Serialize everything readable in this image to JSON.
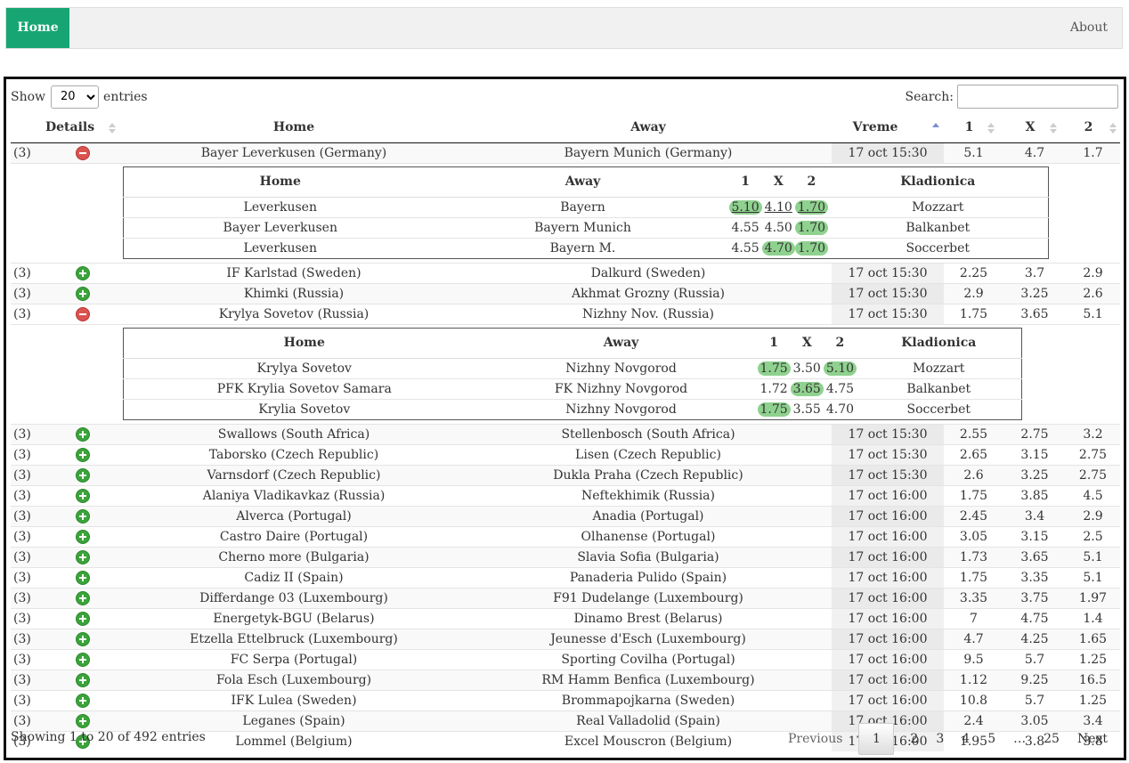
{
  "nav": {
    "home": "Home",
    "about": "About"
  },
  "length": {
    "show": "Show",
    "value": "20",
    "entries": "entries"
  },
  "search": {
    "label": "Search:",
    "value": ""
  },
  "columns": [
    "",
    "Details",
    "Home",
    "Away",
    "Vreme",
    "1",
    "X",
    "2"
  ],
  "rows": [
    {
      "count": "(3)",
      "open": true,
      "home": "Bayer Leverkusen (Germany)",
      "away": "Bayern Munich (Germany)",
      "time": "17 oct 15:30",
      "o1": "5.1",
      "ox": "4.7",
      "o2": "1.7",
      "details": [
        {
          "home": "Leverkusen",
          "away": "Bayern",
          "o1": "5.10",
          "ox": "4.10",
          "o2": "1.70",
          "book": "Mozzart",
          "hl": [
            1,
            0,
            1
          ],
          "ul": [
            1,
            1,
            1
          ]
        },
        {
          "home": "Bayer Leverkusen",
          "away": "Bayern Munich",
          "o1": "4.55",
          "ox": "4.50",
          "o2": "1.70",
          "book": "Balkanbet",
          "hl": [
            0,
            0,
            1
          ],
          "ul": [
            0,
            0,
            0
          ]
        },
        {
          "home": "Leverkusen",
          "away": "Bayern M.",
          "o1": "4.55",
          "ox": "4.70",
          "o2": "1.70",
          "book": "Soccerbet",
          "hl": [
            0,
            1,
            1
          ],
          "ul": [
            0,
            0,
            0
          ]
        }
      ]
    },
    {
      "count": "(3)",
      "open": false,
      "home": "IF Karlstad (Sweden)",
      "away": "Dalkurd (Sweden)",
      "time": "17 oct 15:30",
      "o1": "2.25",
      "ox": "3.7",
      "o2": "2.9"
    },
    {
      "count": "(3)",
      "open": false,
      "home": "Khimki (Russia)",
      "away": "Akhmat Grozny (Russia)",
      "time": "17 oct 15:30",
      "o1": "2.9",
      "ox": "3.25",
      "o2": "2.6"
    },
    {
      "count": "(3)",
      "open": true,
      "home": "Krylya Sovetov (Russia)",
      "away": "Nizhny Nov. (Russia)",
      "time": "17 oct 15:30",
      "o1": "1.75",
      "ox": "3.65",
      "o2": "5.1",
      "details": [
        {
          "home": "Krylya Sovetov",
          "away": "Nizhny Novgorod",
          "o1": "1.75",
          "ox": "3.50",
          "o2": "5.10",
          "book": "Mozzart",
          "hl": [
            1,
            0,
            1
          ],
          "ul": [
            0,
            0,
            0
          ]
        },
        {
          "home": "PFK Krylia Sovetov Samara",
          "away": "FK Nizhny Novgorod",
          "o1": "1.72",
          "ox": "3.65",
          "o2": "4.75",
          "book": "Balkanbet",
          "hl": [
            0,
            1,
            0
          ],
          "ul": [
            0,
            0,
            0
          ]
        },
        {
          "home": "Krylia Sovetov",
          "away": "Nizhny Novgorod",
          "o1": "1.75",
          "ox": "3.55",
          "o2": "4.70",
          "book": "Soccerbet",
          "hl": [
            1,
            0,
            0
          ],
          "ul": [
            0,
            0,
            0
          ]
        }
      ]
    },
    {
      "count": "(3)",
      "open": false,
      "home": "Swallows (South Africa)",
      "away": "Stellenbosch (South Africa)",
      "time": "17 oct 15:30",
      "o1": "2.55",
      "ox": "2.75",
      "o2": "3.2"
    },
    {
      "count": "(3)",
      "open": false,
      "home": "Taborsko (Czech Republic)",
      "away": "Lisen (Czech Republic)",
      "time": "17 oct 15:30",
      "o1": "2.65",
      "ox": "3.15",
      "o2": "2.75"
    },
    {
      "count": "(3)",
      "open": false,
      "home": "Varnsdorf (Czech Republic)",
      "away": "Dukla Praha (Czech Republic)",
      "time": "17 oct 15:30",
      "o1": "2.6",
      "ox": "3.25",
      "o2": "2.75"
    },
    {
      "count": "(3)",
      "open": false,
      "home": "Alaniya Vladikavkaz (Russia)",
      "away": "Neftekhimik (Russia)",
      "time": "17 oct 16:00",
      "o1": "1.75",
      "ox": "3.85",
      "o2": "4.5"
    },
    {
      "count": "(3)",
      "open": false,
      "home": "Alverca (Portugal)",
      "away": "Anadia (Portugal)",
      "time": "17 oct 16:00",
      "o1": "2.45",
      "ox": "3.4",
      "o2": "2.9"
    },
    {
      "count": "(3)",
      "open": false,
      "home": "Castro Daire (Portugal)",
      "away": "Olhanense (Portugal)",
      "time": "17 oct 16:00",
      "o1": "3.05",
      "ox": "3.15",
      "o2": "2.5"
    },
    {
      "count": "(3)",
      "open": false,
      "home": "Cherno more (Bulgaria)",
      "away": "Slavia Sofia (Bulgaria)",
      "time": "17 oct 16:00",
      "o1": "1.73",
      "ox": "3.65",
      "o2": "5.1"
    },
    {
      "count": "(3)",
      "open": false,
      "home": "Cadiz II (Spain)",
      "away": "Panaderia Pulido (Spain)",
      "time": "17 oct 16:00",
      "o1": "1.75",
      "ox": "3.35",
      "o2": "5.1"
    },
    {
      "count": "(3)",
      "open": false,
      "home": "Differdange 03 (Luxembourg)",
      "away": "F91 Dudelange (Luxembourg)",
      "time": "17 oct 16:00",
      "o1": "3.35",
      "ox": "3.75",
      "o2": "1.97"
    },
    {
      "count": "(3)",
      "open": false,
      "home": "Energetyk-BGU (Belarus)",
      "away": "Dinamo Brest (Belarus)",
      "time": "17 oct 16:00",
      "o1": "7",
      "ox": "4.75",
      "o2": "1.4"
    },
    {
      "count": "(3)",
      "open": false,
      "home": "Etzella Ettelbruck (Luxembourg)",
      "away": "Jeunesse d'Esch (Luxembourg)",
      "time": "17 oct 16:00",
      "o1": "4.7",
      "ox": "4.25",
      "o2": "1.65"
    },
    {
      "count": "(3)",
      "open": false,
      "home": "FC Serpa (Portugal)",
      "away": "Sporting Covilha (Portugal)",
      "time": "17 oct 16:00",
      "o1": "9.5",
      "ox": "5.7",
      "o2": "1.25"
    },
    {
      "count": "(3)",
      "open": false,
      "home": "Fola Esch (Luxembourg)",
      "away": "RM Hamm Benfica (Luxembourg)",
      "time": "17 oct 16:00",
      "o1": "1.12",
      "ox": "9.25",
      "o2": "16.5"
    },
    {
      "count": "(3)",
      "open": false,
      "home": "IFK Lulea (Sweden)",
      "away": "Brommapojkarna (Sweden)",
      "time": "17 oct 16:00",
      "o1": "10.8",
      "ox": "5.7",
      "o2": "1.25"
    },
    {
      "count": "(3)",
      "open": false,
      "home": "Leganes (Spain)",
      "away": "Real Valladolid (Spain)",
      "time": "17 oct 16:00",
      "o1": "2.4",
      "ox": "3.05",
      "o2": "3.4"
    },
    {
      "count": "(3)",
      "open": false,
      "home": "Lommel (Belgium)",
      "away": "Excel Mouscron (Belgium)",
      "time": "17 oct 16:00",
      "o1": "1.95",
      "ox": "3.8",
      "o2": "3.8"
    }
  ],
  "detail_columns": [
    "Home",
    "Away",
    "1",
    "X",
    "2",
    "Kladionica"
  ],
  "info": "Showing 1 to 20 of 492 entries",
  "pager": {
    "previous": "Previous",
    "pages": [
      "1",
      "2",
      "3",
      "4",
      "5",
      "…",
      "25"
    ],
    "current": "1",
    "next": "Next"
  }
}
